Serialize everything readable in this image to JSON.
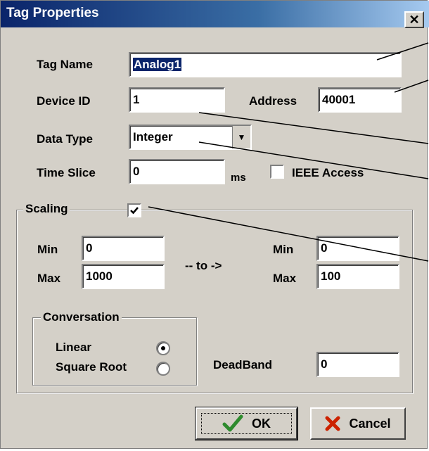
{
  "dialog": {
    "title": "Tag Properties",
    "close_glyph": "✕"
  },
  "tag_name": {
    "label": "Tag Name",
    "value": "Analog1"
  },
  "device_id": {
    "label": "Device ID",
    "value": "1"
  },
  "address": {
    "label": "Address",
    "value": "40001"
  },
  "data_type": {
    "label": "Data Type",
    "value": "Integer"
  },
  "time_slice": {
    "label": "Time Slice",
    "value": "0",
    "unit": "ms"
  },
  "ieee": {
    "label": "IEEE Access",
    "checked": false
  },
  "scaling": {
    "label": "Scaling",
    "checked": true,
    "min_label": "Min",
    "max_label": "Max",
    "input_min": "0",
    "input_max": "1000",
    "to_label": "-- to ->",
    "output_min": "0",
    "output_max": "100"
  },
  "conversation": {
    "legend": "Conversation",
    "linear_label": "Linear",
    "sqrt_label": "Square Root",
    "selected": "Linear"
  },
  "deadband": {
    "label": "DeadBand",
    "value": "0"
  },
  "buttons": {
    "ok": "OK",
    "cancel": "Cancel"
  },
  "colors": {
    "titlebar": "#0a246a",
    "face": "#d4d0c8",
    "ok_check": "#2e8b2e",
    "cancel_x": "#cc2200"
  }
}
